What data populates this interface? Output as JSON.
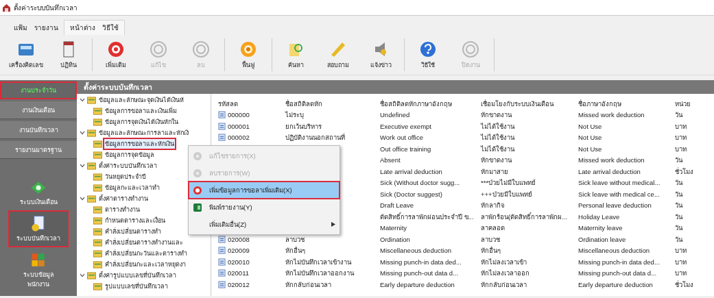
{
  "window": {
    "title": "ตั้งค่าระบบบันทึกเวลา"
  },
  "menu_groups": [
    [
      "แฟ้ม",
      "รายงาน"
    ],
    [
      "หน้าต่าง",
      "วิธีใช้"
    ]
  ],
  "toolbar_groups": [
    [
      {
        "label": "เครื่องคิดเลข",
        "kind": "calculator",
        "disabled": false
      },
      {
        "label": "ปฏิทิน",
        "kind": "calendar",
        "disabled": false
      }
    ],
    [
      {
        "label": "เพิ่มเติม",
        "kind": "add",
        "disabled": false
      },
      {
        "label": "แก้ไข",
        "kind": "edit",
        "disabled": true
      },
      {
        "label": "ลบ",
        "kind": "delete",
        "disabled": true
      }
    ],
    [
      {
        "label": "ฟื้นฟู",
        "kind": "refresh",
        "disabled": false
      }
    ],
    [
      {
        "label": "ค้นหา",
        "kind": "search",
        "disabled": false
      },
      {
        "label": "สอบถาม",
        "kind": "inquiry",
        "disabled": false
      },
      {
        "label": "แจ้งข่าว",
        "kind": "news",
        "disabled": false
      }
    ],
    [
      {
        "label": "วิธีใช้",
        "kind": "help",
        "disabled": false
      },
      {
        "label": "ปิดงาน",
        "kind": "exit",
        "disabled": true
      }
    ]
  ],
  "sidebar": {
    "buttons": [
      {
        "label": "งานประจำวัน",
        "selected": true,
        "highlighted": true
      },
      {
        "label": "งานเงินเดือน",
        "selected": false,
        "highlighted": false
      },
      {
        "label": "งานบันทึกเวลา",
        "selected": false,
        "highlighted": false
      },
      {
        "label": "รายงานมาตรฐาน",
        "selected": false,
        "highlighted": false
      }
    ],
    "modules": [
      {
        "label": "ระบบเงินเดือน",
        "kind": "payroll",
        "highlighted": false
      },
      {
        "label": "ระบบบันทึกเวลา",
        "kind": "time",
        "highlighted": true
      },
      {
        "label": "ระบบข้อมูล พนักงาน",
        "kind": "staff",
        "highlighted": false
      }
    ]
  },
  "panel": {
    "title": "ตั้งค่าระบบบันทึกเวลา",
    "tree": [
      {
        "label": "ข้อมูลและลักษณะจุดเงินได้เงินหั",
        "expanded": true,
        "selected": false,
        "highlighted": false,
        "children": [
          {
            "label": "ข้อมูลการขอลาและเงินเพิ่ม",
            "selected": false,
            "highlighted": false
          },
          {
            "label": "ข้อมูลการจุดเงินได้เงินหักใน",
            "selected": false,
            "highlighted": false
          }
        ]
      },
      {
        "label": "ข้อมูลและลักษณะการลาและหักเงิ",
        "expanded": true,
        "selected": false,
        "highlighted": false,
        "children": [
          {
            "label": "ข้อมูลการขอลาและหักเงิน",
            "selected": true,
            "highlighted": true
          },
          {
            "label": "ข้อมูลการจุดข้อมูล",
            "selected": false,
            "highlighted": false
          }
        ]
      },
      {
        "label": "ตั้งค่าระบบบันทึกเวลา",
        "expanded": true,
        "selected": false,
        "highlighted": false,
        "children": [
          {
            "label": "วันหยุดประจำปี",
            "selected": false,
            "highlighted": false
          },
          {
            "label": "ข้อมูลกะและเวลาทำ",
            "selected": false,
            "highlighted": false
          }
        ]
      },
      {
        "label": "ตั้งค่าตารางทำงาน",
        "expanded": true,
        "selected": false,
        "highlighted": false,
        "children": [
          {
            "label": "ตารางทำงาน",
            "selected": false,
            "highlighted": false
          },
          {
            "label": "กำหนดตารางและเงื่อน",
            "selected": false,
            "highlighted": false
          },
          {
            "label": "คำสั่งเปลี่ยนตารางทำ",
            "selected": false,
            "highlighted": false
          },
          {
            "label": "คำสั่งเปลี่ยนตารางทำงานและ",
            "selected": false,
            "highlighted": false
          },
          {
            "label": "คำสั่งเปลี่ยนกะวันและตารางทำ",
            "selected": false,
            "highlighted": false
          },
          {
            "label": "คำสั่งเปลี่ยนกะและเวลาหยุดงา",
            "selected": false,
            "highlighted": false
          }
        ]
      },
      {
        "label": "ตั้งค่ารูปแบบเลขที่บันทึกเวลา",
        "expanded": true,
        "selected": false,
        "highlighted": false,
        "children": [
          {
            "label": "รูปแบบเลขที่บันทึกเวลา",
            "selected": false,
            "highlighted": false
          }
        ]
      }
    ],
    "table": {
      "columns": [
        "รหัสลด",
        "ชื่อสถิติลดหัก",
        "ชื่อสถิติลดหักภาษาอังกฤษ",
        "เชื่อมโยงกับระบบเงินเดือน",
        "ชื่อภาษาอังกฤษ",
        "หน่วย"
      ],
      "rows": [
        {
          "code": "000000",
          "name": "ไม่ระบุ",
          "name_en": "Undefined",
          "payroll_link": "หักขาดงาน",
          "payroll_en": "Missed work deduction",
          "unit": "วัน"
        },
        {
          "code": "000001",
          "name": "ยกเว้นบริหาร",
          "name_en": "Executive exempt",
          "payroll_link": "ไม่ได้ใช้งาน",
          "payroll_en": "Not Use",
          "unit": "บาท"
        },
        {
          "code": "000002",
          "name": "ปฏิบัติงานนอกสถานที่",
          "name_en": "Work out office",
          "payroll_link": "ไม่ได้ใช้งาน",
          "payroll_en": "Not Use",
          "unit": "บาท"
        },
        {
          "name_en": "Out office training",
          "payroll_link": "ไม่ได้ใช้งาน",
          "payroll_en": "Not Use",
          "unit": "บาท"
        },
        {
          "name_en": "Absent",
          "payroll_link": "หักขาดงาน",
          "payroll_en": "Missed work deduction",
          "unit": "วัน"
        },
        {
          "name_en": "Late arrival deduction",
          "payroll_link": "หักมาสาย",
          "payroll_en": "Late arrival deduction",
          "unit": "ชั่วโมง"
        },
        {
          "name_en": "Sick (Without doctor sugg...",
          "payroll_link": "***ป่วยไม่มีใบแพทย์",
          "payroll_en": "Sick leave without medical...",
          "unit": "วัน"
        },
        {
          "name_en": "Sick (Doctor suggest)",
          "payroll_link": "+++ป่วยมีใบแพทย์",
          "payroll_en": "Sick leave with medical ce...",
          "unit": "วัน"
        },
        {
          "name_en": "Draft Leave",
          "payroll_link": "หักลากิจ",
          "payroll_en": "Personal leave deduction",
          "unit": "วัน"
        },
        {
          "name_en": "ตัดสิทธิ์การลาพักผ่อนประจำปี ข...",
          "payroll_link": "ลาพักร้อน(ตัดสิทธิ์การลาพักผ...",
          "payroll_en": "Holiday Leave",
          "unit": "วัน"
        },
        {
          "name_en": "Maternity",
          "payroll_link": "ลาคลอด",
          "payroll_en": "Maternity leave",
          "unit": "วัน"
        },
        {
          "code": "020008",
          "name": "ลาบวช",
          "name_en": "Ordination",
          "payroll_link": "ลาบวช",
          "payroll_en": "Ordination leave",
          "unit": "วัน"
        },
        {
          "code": "020009",
          "name": "หักอื่นๆ",
          "name_en": "Miscellaneous deduction",
          "payroll_link": "หักอื่นๆ",
          "payroll_en": "Miscellaneous deduction",
          "unit": "บาท"
        },
        {
          "code": "020010",
          "name": "หักไม่บันทึกเวลาเข้างาน",
          "name_en": "Missing punch-in data ded...",
          "payroll_link": "หักไม่ลงเวลาเข้า",
          "payroll_en": "Missing punch-in data ded...",
          "unit": "บาท"
        },
        {
          "code": "020011",
          "name": "หักไม่บันทึกเวลาออกงาน",
          "name_en": "Missing punch-out data d...",
          "payroll_link": "หักไม่ลงเวลาออก",
          "payroll_en": "Missing punch-out data d...",
          "unit": "บาท"
        },
        {
          "code": "020012",
          "name": "หักกลับก่อนเวลา",
          "name_en": "Early departure deduction",
          "payroll_link": "หักกลับก่อนเวลา",
          "payroll_en": "Early departure deduction",
          "unit": "ชั่วโมง"
        }
      ]
    },
    "context_menu": [
      {
        "label": "แก้ไขรายการ(X)",
        "kind": "gear",
        "disabled": true,
        "selected": false,
        "highlighted": false,
        "submenu": false
      },
      {
        "label": "ลบรายการ(W)",
        "kind": "gear",
        "disabled": true,
        "selected": false,
        "highlighted": false,
        "submenu": false
      },
      {
        "label": "เพิ่มข้อมูลการขอลาเพิ่มเติม(X)",
        "kind": "add",
        "disabled": false,
        "selected": true,
        "highlighted": true,
        "submenu": false
      },
      {
        "label": "พิมพ์รายงาน(Y)",
        "kind": "excel",
        "disabled": false,
        "selected": false,
        "highlighted": false,
        "submenu": false
      },
      {
        "label": "เพิ่มเติมอื่น(Z)",
        "kind": "none",
        "disabled": false,
        "selected": false,
        "highlighted": false,
        "submenu": true
      }
    ]
  }
}
